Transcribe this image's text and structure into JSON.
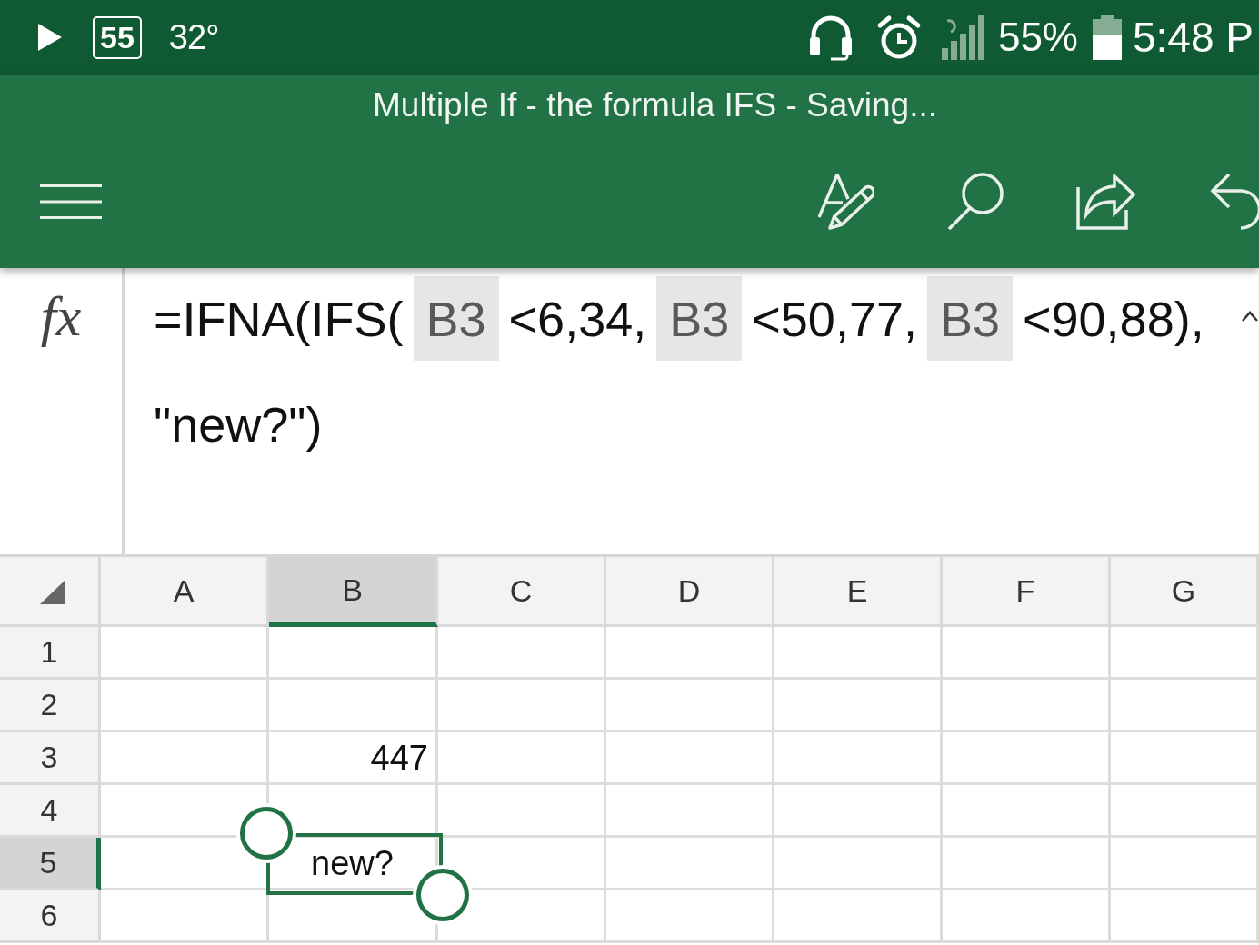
{
  "status_bar": {
    "notification_count": "55",
    "temperature": "32°",
    "battery": "55%",
    "time": "5:48 P"
  },
  "title_bar": {
    "title": "Multiple If - the formula IFS - Saving..."
  },
  "formula_bar": {
    "function_label": "fx",
    "lines": [
      [
        {
          "kind": "text",
          "text": "=IFNA(IFS("
        },
        {
          "kind": "reference",
          "text": "B3"
        },
        {
          "kind": "text",
          "text": "<6,34,"
        },
        {
          "kind": "reference",
          "text": "B3"
        },
        {
          "kind": "text",
          "text": "<50,77,"
        },
        {
          "kind": "reference",
          "text": "B3"
        },
        {
          "kind": "text",
          "text": "<90,88),"
        }
      ],
      [
        {
          "kind": "text",
          "text": "\"new?\")"
        }
      ]
    ]
  },
  "sheet": {
    "columns": [
      {
        "label": "A",
        "selected": false
      },
      {
        "label": "B",
        "selected": true
      },
      {
        "label": "C",
        "selected": false
      },
      {
        "label": "D",
        "selected": false
      },
      {
        "label": "E",
        "selected": false
      },
      {
        "label": "F",
        "selected": false
      },
      {
        "label": "G",
        "selected": false
      }
    ],
    "rows": [
      {
        "label": "1",
        "selected": false
      },
      {
        "label": "2",
        "selected": false
      },
      {
        "label": "3",
        "selected": false,
        "cells": [
          null,
          {
            "kind": "number",
            "value": "447"
          }
        ]
      },
      {
        "label": "4",
        "selected": false
      },
      {
        "label": "5",
        "selected": true,
        "cells": [
          null,
          {
            "kind": "text",
            "value": "new?"
          }
        ]
      },
      {
        "label": "6",
        "selected": false
      }
    ]
  }
}
